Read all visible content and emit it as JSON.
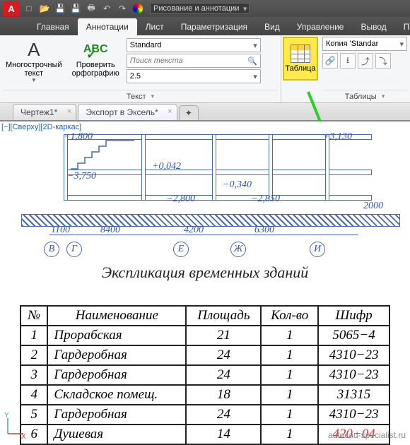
{
  "qat": {
    "logo": "A",
    "workspace": "Рисование и аннотации"
  },
  "ribbon_tabs": [
    "Главная",
    "Аннотации",
    "Лист",
    "Параметризация",
    "Вид",
    "Управление",
    "Вывод",
    "Подкл"
  ],
  "active_ribbon_tab": "Аннотации",
  "panel_text": {
    "mtext_top": "Многострочный",
    "mtext_bot": "текст",
    "spell_top": "Проверить",
    "spell_bot": "орфографию",
    "title": "Текст",
    "style": "Standard",
    "search_ph": "Поиск текста",
    "height": "2.5"
  },
  "panel_table": {
    "label": "Таблица",
    "title": "Таблицы",
    "copy": "Копия 'Standar"
  },
  "doc_tabs": [
    {
      "label": "Чертеж1*",
      "active": false
    },
    {
      "label": "Экспорт в Эксель*",
      "active": true
    }
  ],
  "viewctl": "[−][Сверху][2D-каркас]",
  "drawing": {
    "elev_top": "+3,130",
    "elev_mid": "+0,042",
    "elev_b1": "−0,340",
    "elev_b2": "−2,800",
    "elev_b3": "−2,850",
    "elev_b4": "−3,750",
    "elev_left": "−1,800",
    "dim_right": "2000",
    "dims": [
      "1100",
      "8400",
      "4200",
      "6300"
    ],
    "axes": [
      "В",
      "Г",
      "Е",
      "Ж",
      "И"
    ]
  },
  "explication": {
    "title": "Экспликация временных зданий",
    "headers": {
      "n": "№",
      "name": "Наименование",
      "area": "Площадь",
      "qty": "Кол-во",
      "code": "Шифр"
    },
    "rows": [
      {
        "n": "1",
        "name": "Прорабская",
        "area": "21",
        "qty": "1",
        "code": "5065−4"
      },
      {
        "n": "2",
        "name": "Гардеробная",
        "area": "24",
        "qty": "1",
        "code": "4310−23"
      },
      {
        "n": "3",
        "name": "Гардеробная",
        "area": "24",
        "qty": "1",
        "code": "4310−23"
      },
      {
        "n": "4",
        "name": "Складское помещ.",
        "area": "18",
        "qty": "1",
        "code": "31315"
      },
      {
        "n": "5",
        "name": "Гардеробная",
        "area": "24",
        "qty": "1",
        "code": "4310−23"
      },
      {
        "n": "6",
        "name": "Душевая",
        "area": "14",
        "qty": "1",
        "code": "420−04"
      }
    ]
  },
  "watermark": "autocad-specialist.ru"
}
